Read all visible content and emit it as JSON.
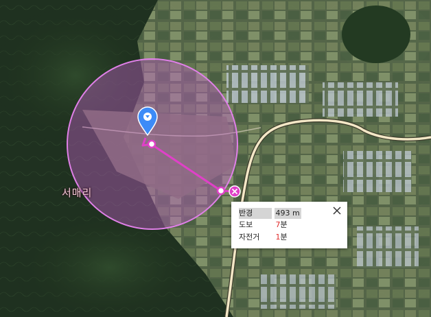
{
  "map": {
    "place_label": "서매리",
    "circle_color": "#d070d0",
    "route_color": "#e040c8",
    "road_color": "#f3e7c6",
    "pin_color": "#3d8bf7"
  },
  "info_panel": {
    "radius_label": "반경",
    "radius_value": "493 m",
    "walk_label": "도보",
    "walk_minutes": "7",
    "walk_unit": "분",
    "bike_label": "자전거",
    "bike_minutes": "1",
    "bike_unit": "분"
  },
  "icons": {
    "pin": "location-pin-icon",
    "close": "close-icon",
    "remove_point": "remove-point-icon"
  }
}
